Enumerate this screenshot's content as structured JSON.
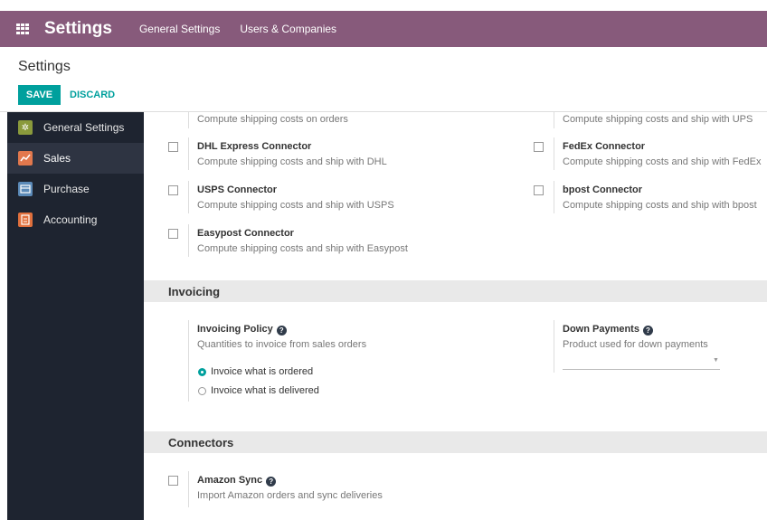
{
  "topbar": {
    "app_title": "Settings",
    "menu": [
      "General Settings",
      "Users & Companies"
    ]
  },
  "control_panel": {
    "breadcrumb": "Settings",
    "save_label": "SAVE",
    "discard_label": "DISCARD"
  },
  "sidebar": {
    "items": [
      {
        "label": "General Settings",
        "icon": "gear-icon",
        "color": "#8a9a3c"
      },
      {
        "label": "Sales",
        "icon": "sales-chart-icon",
        "color": "#e2784d"
      },
      {
        "label": "Purchase",
        "icon": "purchase-card-icon",
        "color": "#5b8ab8"
      },
      {
        "label": "Accounting",
        "icon": "accounting-icon",
        "color": "#e0703d"
      }
    ]
  },
  "shipping": {
    "partial_desc": "Compute shipping costs on orders",
    "partial_desc_right": "Compute shipping costs and ship with UPS",
    "dhl": {
      "title": "DHL Express Connector",
      "desc": "Compute shipping costs and ship with DHL"
    },
    "fedex": {
      "title": "FedEx Connector",
      "desc": "Compute shipping costs and ship with FedEx"
    },
    "usps": {
      "title": "USPS Connector",
      "desc": "Compute shipping costs and ship with USPS"
    },
    "bpost": {
      "title": "bpost Connector",
      "desc": "Compute shipping costs and ship with bpost"
    },
    "easypost": {
      "title": "Easypost Connector",
      "desc": "Compute shipping costs and ship with Easypost"
    }
  },
  "invoicing": {
    "header": "Invoicing",
    "policy_title": "Invoicing Policy",
    "policy_desc": "Quantities to invoice from sales orders",
    "options": [
      "Invoice what is ordered",
      "Invoice what is delivered"
    ],
    "selected_option": 0,
    "down_payments_title": "Down Payments",
    "down_payments_desc": "Product used for down payments",
    "down_payments_value": ""
  },
  "connectors": {
    "header": "Connectors",
    "amazon_title": "Amazon Sync",
    "amazon_desc": "Import Amazon orders and sync deliveries"
  },
  "colors": {
    "topbar": "#875a7b",
    "accent": "#00a09d",
    "sidebar": "#1e2430"
  }
}
